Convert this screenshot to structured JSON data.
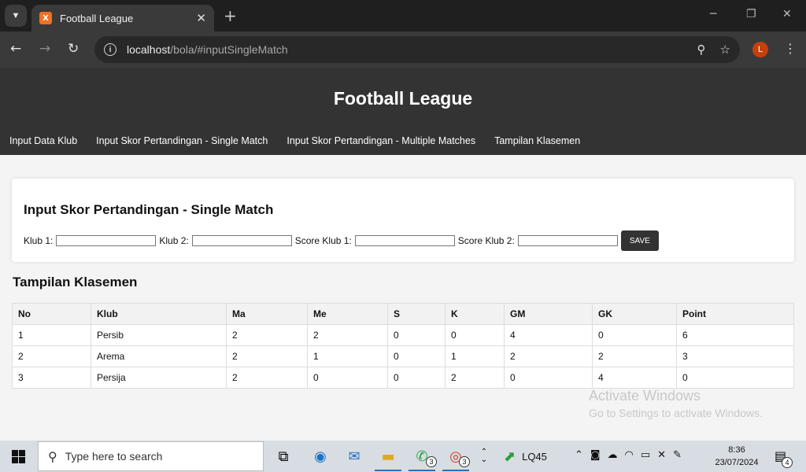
{
  "browser": {
    "tab_title": "Football League",
    "tab_close": "✕",
    "new_tab": "+",
    "url_host": "localhost",
    "url_path": "/bola/#inputSingleMatch",
    "profile_initial": "L",
    "favicon_letter": "X"
  },
  "site": {
    "title": "Football League",
    "nav": [
      "Input Data Klub",
      "Input Skor Pertandingan - Single Match",
      "Input Skor Pertandingan - Multiple Matches",
      "Tampilan Klasemen"
    ]
  },
  "form": {
    "title": "Input Skor Pertandingan - Single Match",
    "klub1_label": "Klub 1:",
    "klub2_label": "Klub 2:",
    "score1_label": "Score Klub 1:",
    "score2_label": "Score Klub 2:",
    "klub1_value": "",
    "klub2_value": "",
    "score1_value": "",
    "score2_value": "",
    "save_label": "SAVE"
  },
  "klasemen": {
    "title": "Tampilan Klasemen",
    "headers": [
      "No",
      "Klub",
      "Ma",
      "Me",
      "S",
      "K",
      "GM",
      "GK",
      "Point"
    ],
    "rows": [
      [
        "1",
        "Persib",
        "2",
        "2",
        "0",
        "0",
        "4",
        "0",
        "6"
      ],
      [
        "2",
        "Arema",
        "2",
        "1",
        "0",
        "1",
        "2",
        "2",
        "3"
      ],
      [
        "3",
        "Persija",
        "2",
        "0",
        "0",
        "2",
        "0",
        "4",
        "0"
      ]
    ]
  },
  "watermark": {
    "line1": "Activate Windows",
    "line2": "Go to Settings to activate Windows."
  },
  "taskbar": {
    "search_placeholder": "Type here to search",
    "whatsapp_badge": "3",
    "chrome_badge": "3",
    "stock_label": "LQ45",
    "time": "8:36",
    "date": "23/07/2024",
    "notification_count": "4"
  },
  "colors": {
    "header_bg": "#333333",
    "accent_favicon": "#f37021",
    "profile_bg": "#c2410c"
  }
}
